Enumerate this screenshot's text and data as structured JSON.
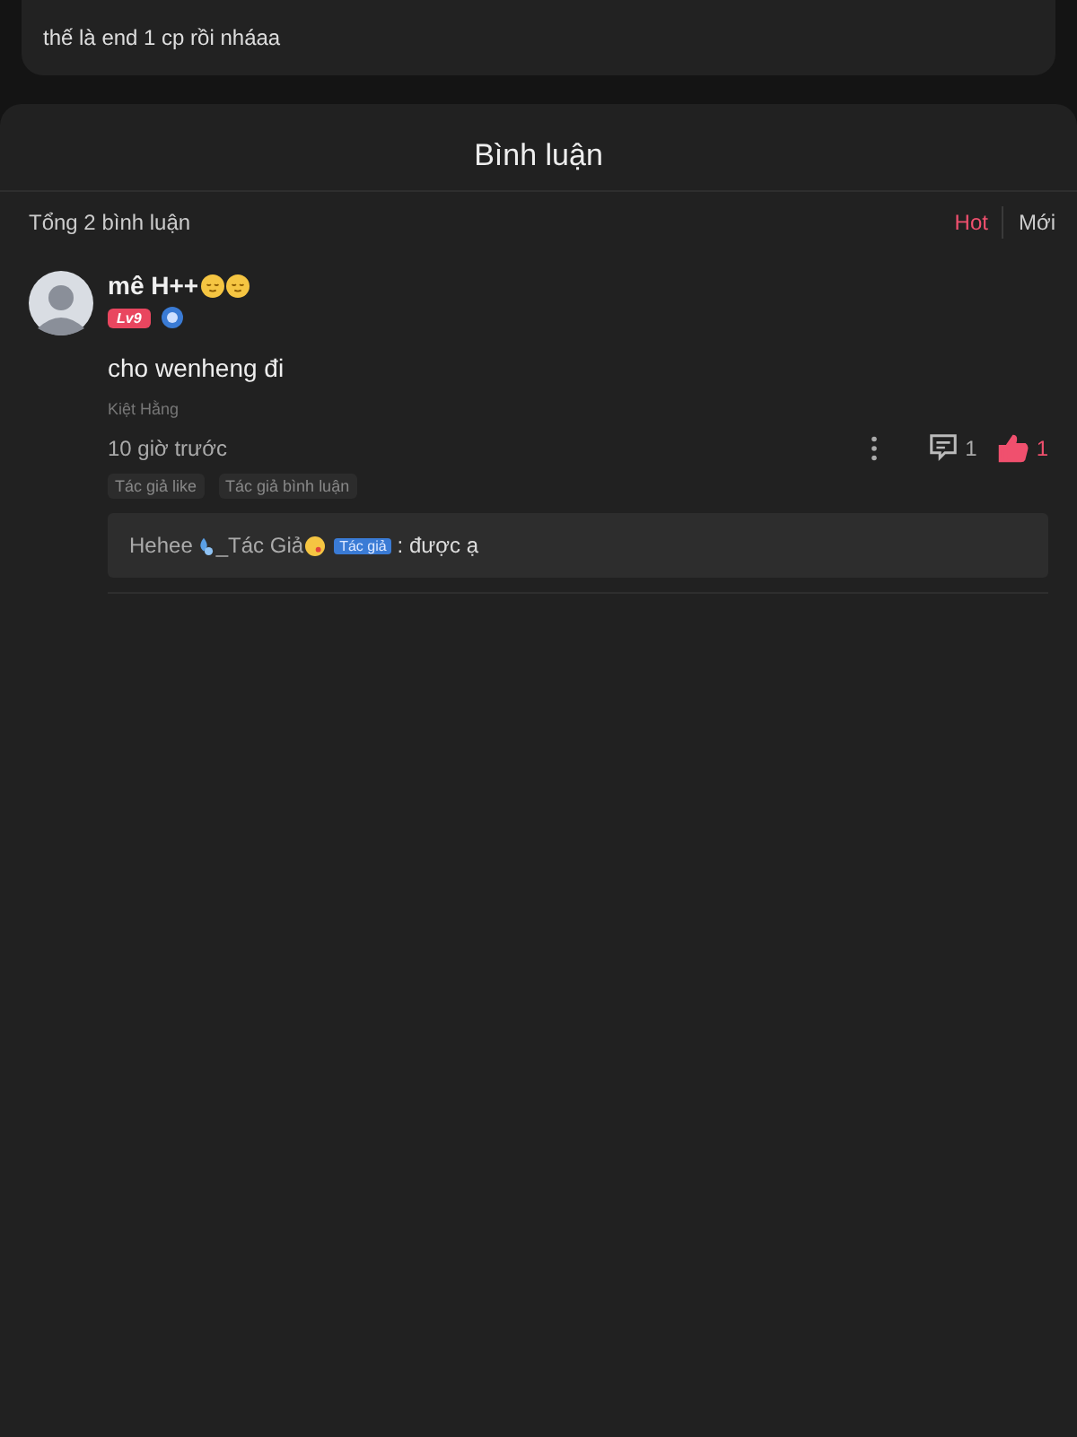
{
  "previous_comment": {
    "text": "thế là end 1 cp rồi nháaa"
  },
  "sheet_title": "Bình luận",
  "total": "Tổng 2 bình luận",
  "sort_tabs": [
    {
      "label": "Hot",
      "selected": true
    },
    {
      "label": "Mới",
      "selected": false
    }
  ],
  "comment": {
    "username": "mê H++",
    "level_badge": "Lv9",
    "text": "cho wenheng đi",
    "chapter": "Kiệt Hằng",
    "time": "10 giờ trước",
    "reply_count": "1",
    "like_count": "1",
    "liked": true,
    "tags": [
      "Tác giả like",
      "Tác giả bình luận"
    ],
    "reply": {
      "name_start": "Hehee",
      "name_end": "_Tác Giả",
      "role_badge": "Tác giả",
      "text": ": được ạ"
    }
  }
}
